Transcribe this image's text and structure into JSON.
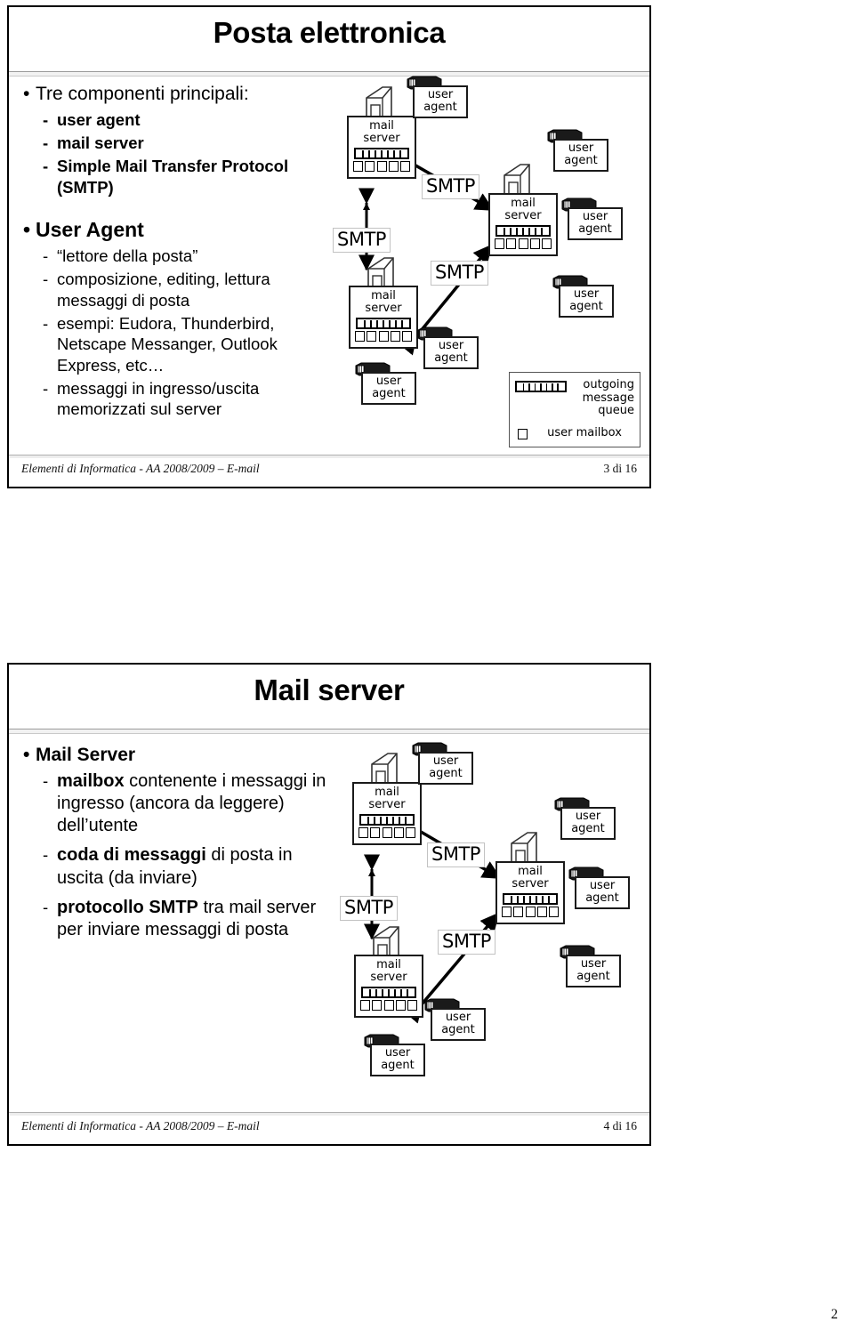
{
  "document": {
    "page_number": "2"
  },
  "slides": [
    {
      "title": "Posta elettronica",
      "bullets": [
        {
          "level": 1,
          "text": "Tre componenti principali:",
          "bold": false
        },
        {
          "level": 2,
          "text": "user agent",
          "bold": true
        },
        {
          "level": 2,
          "text": "mail server",
          "bold": true
        },
        {
          "level": 2,
          "text": "Simple Mail Transfer Protocol (SMTP)",
          "bold": true
        },
        {
          "level": 1,
          "text": "User Agent",
          "bold": true
        },
        {
          "level": 2,
          "text": "“lettore della posta”",
          "bold": false
        },
        {
          "level": 2,
          "text": "composizione, editing, lettura messaggi di posta",
          "bold": false
        },
        {
          "level": 2,
          "text": "esempi: Eudora, Thunderbird, Netscape Messanger, Outlook Express, etc…",
          "bold": false
        },
        {
          "level": 2,
          "text": "messaggi in ingresso/uscita memorizzati sul server",
          "bold": false
        }
      ],
      "footer": {
        "left": "Elementi di Informatica - AA 2008/2009 – E-mail",
        "right": "3 di 16"
      },
      "diagram": {
        "mail_server_label_line1": "mail",
        "mail_server_label_line2": "server",
        "user_agent_label_line1": "user",
        "user_agent_label_line2": "agent",
        "smtp_labels": [
          "SMTP",
          "SMTP",
          "SMTP"
        ],
        "legend": {
          "queue_text_line1": "outgoing",
          "queue_text_line2": "message queue",
          "mailbox_text": "user mailbox"
        },
        "queue_ticks": 7,
        "mailbox_count": 5,
        "mail_servers": 3,
        "user_agents": 6
      }
    },
    {
      "title": "Mail server",
      "bullets": [
        {
          "level": 1,
          "text": "Mail Server",
          "bold": true
        },
        {
          "level": 2,
          "html": "<b>mailbox</b> contenente i messaggi in ingresso (ancora da leggere) dell’utente",
          "text": "mailbox contenente i messaggi in ingresso (ancora da leggere) dell’utente",
          "bold": false
        },
        {
          "level": 2,
          "html": "<b>coda di messaggi</b> di posta in uscita (da inviare)",
          "text": "coda di messaggi di posta in uscita (da inviare)",
          "bold": false
        },
        {
          "level": 2,
          "html": "<b>protocollo SMTP</b> tra mail server per inviare messaggi di posta",
          "text": "protocollo SMTP tra mail server per inviare messaggi di posta",
          "bold": false
        }
      ],
      "footer": {
        "left": "Elementi di Informatica - AA 2008/2009 – E-mail",
        "right": "4 di 16"
      },
      "diagram": {
        "mail_server_label_line1": "mail",
        "mail_server_label_line2": "server",
        "user_agent_label_line1": "user",
        "user_agent_label_line2": "agent",
        "smtp_labels": [
          "SMTP",
          "SMTP",
          "SMTP"
        ],
        "legend": null,
        "queue_ticks": 7,
        "mailbox_count": 5,
        "mail_servers": 3,
        "user_agents": 6
      }
    }
  ]
}
